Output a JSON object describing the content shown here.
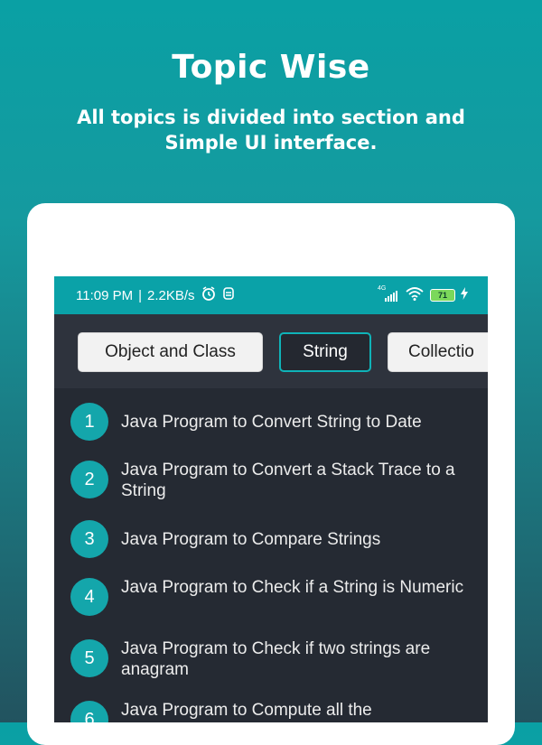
{
  "promo": {
    "title": "Topic Wise",
    "subtitle_line1": "All topics is divided into section and",
    "subtitle_line2": "Simple UI interface."
  },
  "statusbar": {
    "time": "11:09 PM",
    "separator": "|",
    "speed": "2.2KB/s",
    "network": "4G",
    "battery": "71"
  },
  "tabs": [
    {
      "label": "Object and Class",
      "active": false
    },
    {
      "label": "String",
      "active": true
    },
    {
      "label": "Collectio",
      "active": false
    }
  ],
  "items": [
    {
      "num": "1",
      "text": "Java Program to Convert String to Date"
    },
    {
      "num": "2",
      "text": "Java Program to Convert a Stack Trace to a String"
    },
    {
      "num": "3",
      "text": "Java Program to Compare Strings"
    },
    {
      "num": "4",
      "text": "Java Program to Check if a String is Numeric"
    },
    {
      "num": "5",
      "text": "Java Program to Check if two strings are anagram"
    },
    {
      "num": "6",
      "text": "Java Program to Compute all the"
    }
  ],
  "colors": {
    "accent": "#14a6ab",
    "statusbar": "#0aa2a8",
    "list_bg": "#252a33"
  }
}
